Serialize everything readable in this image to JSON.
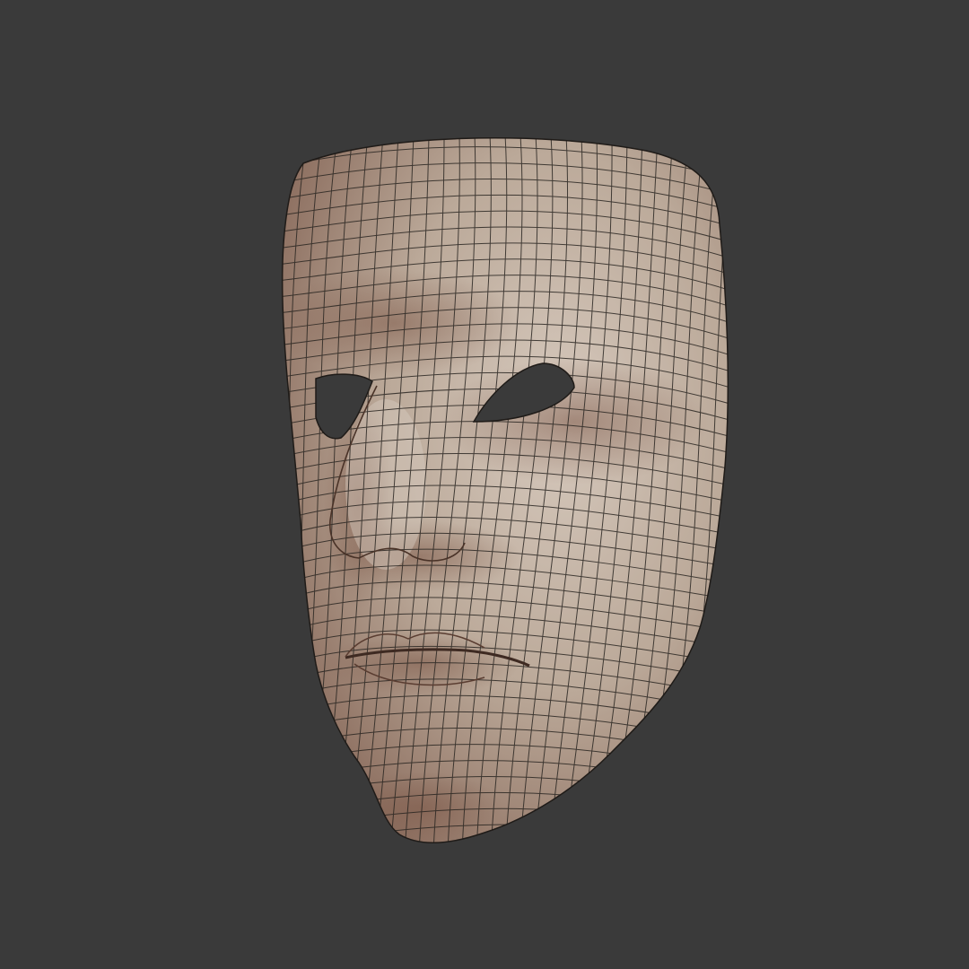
{
  "scene": {
    "subject": "face-mask-wireframe",
    "background_color": "#3a3a3a",
    "mask_color": "#b8a596",
    "mask_shadow_color": "#7a5a4c",
    "mask_highlight_color": "#d3c6ba",
    "wire_color": "#2a2622"
  }
}
